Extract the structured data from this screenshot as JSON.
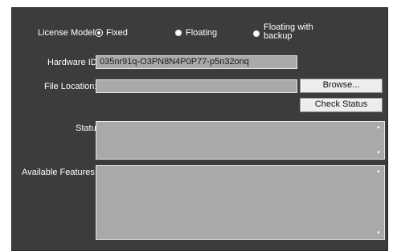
{
  "license": {
    "label": "License Model:",
    "options": [
      {
        "label": "Fixed",
        "selected": true
      },
      {
        "label": "Floating",
        "selected": false
      },
      {
        "label_line1": "Floating with",
        "label_line2": "backup",
        "selected": false
      }
    ]
  },
  "hardware": {
    "label": "Hardware ID:",
    "value": "035nr91q-O3PN8N4P0P77-p5n32onq"
  },
  "file_location": {
    "label": "File Location:",
    "value": "",
    "browse_label": "Browse...",
    "check_status_label": "Check Status"
  },
  "status": {
    "label": "Status:"
  },
  "features": {
    "label": "Available Features:"
  },
  "icons": {
    "scroll_up": "▲",
    "scroll_down": "▼"
  }
}
